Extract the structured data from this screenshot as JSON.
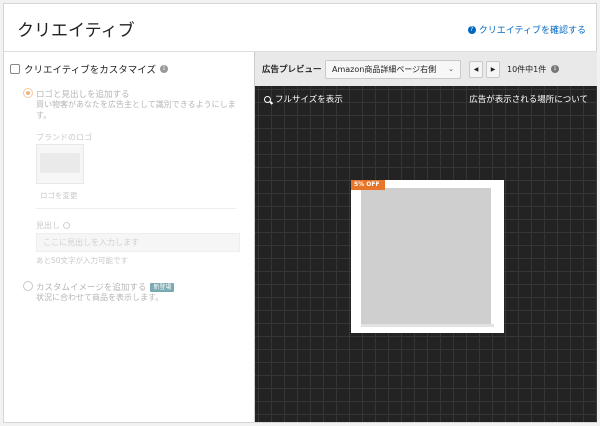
{
  "header": {
    "title": "クリエイティブ",
    "confirm_link": "クリエイティブを確認する"
  },
  "left_panel": {
    "customize_label": "クリエイティブをカスタマイズ",
    "customize_checked": false,
    "option_logo": {
      "label": "ロゴと見出しを追加する",
      "description": "買い物客があなたを広告主として識別できるようにします。",
      "selected": true
    },
    "brand_logo_label": "ブランドのロゴ",
    "logo_change": "ロゴを変更",
    "headline_label": "見出し",
    "headline_placeholder": "ここに見出しを入力します",
    "remaining_text": "あと50文字が入力可能です",
    "option_custom": {
      "label": "カスタムイメージを追加する",
      "badge": "新登場",
      "description": "状況に合わせて商品を表示します。",
      "selected": false
    }
  },
  "preview": {
    "label": "広告プレビュー",
    "placement_select": "Amazon商品詳細ページ右側",
    "count_text": "10件中1件",
    "fullsize_label": "フルサイズを表示",
    "where_shown_label": "広告が表示される場所について",
    "discount_badge": "5% OFF"
  },
  "colors": {
    "link": "#0066c0",
    "stage_bg": "#232323",
    "discount": "#e8762a",
    "badge": "#7aaab1"
  }
}
